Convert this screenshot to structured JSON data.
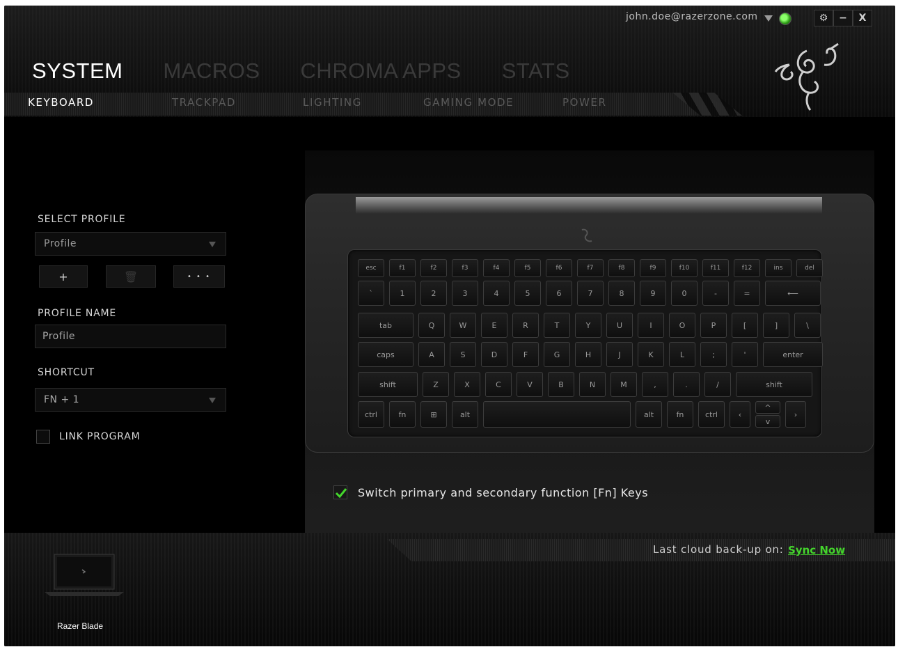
{
  "account": {
    "email": "john.doe@razerzone.com"
  },
  "window_controls": {
    "settings": "⚙",
    "minimize": "−",
    "close": "X"
  },
  "main_tabs": [
    {
      "label": "SYSTEM",
      "active": true
    },
    {
      "label": "MACROS",
      "active": false
    },
    {
      "label": "CHROMA APPS",
      "active": false
    },
    {
      "label": "STATS",
      "active": false
    }
  ],
  "sub_tabs": [
    {
      "label": "KEYBOARD",
      "active": true
    },
    {
      "label": "TRACKPAD",
      "active": false
    },
    {
      "label": "LIGHTING",
      "active": false
    },
    {
      "label": "GAMING MODE",
      "active": false
    },
    {
      "label": "POWER",
      "active": false
    }
  ],
  "profile": {
    "select_label": "SELECT PROFILE",
    "selected": "Profile",
    "add": "+",
    "delete": "🗑",
    "more": "• • •",
    "name_label": "PROFILE NAME",
    "name_value": "Profile",
    "shortcut_label": "SHORTCUT",
    "shortcut_value": "FN + 1",
    "link_program": "LINK PROGRAM"
  },
  "keyboard": {
    "rows": [
      [
        "esc",
        "f1",
        "f2",
        "f3",
        "f4",
        "f5",
        "f6",
        "f7",
        "f8",
        "f9",
        "f10",
        "f11",
        "f12",
        "ins",
        "del"
      ],
      [
        "`",
        "1",
        "2",
        "3",
        "4",
        "5",
        "6",
        "7",
        "8",
        "9",
        "0",
        "-",
        "=",
        "⟵"
      ],
      [
        "tab",
        "Q",
        "W",
        "E",
        "R",
        "T",
        "Y",
        "U",
        "I",
        "O",
        "P",
        "[",
        "]",
        "\\"
      ],
      [
        "caps",
        "A",
        "S",
        "D",
        "F",
        "G",
        "H",
        "J",
        "K",
        "L",
        ";",
        "'",
        "enter"
      ],
      [
        "shift",
        "Z",
        "X",
        "C",
        "V",
        "B",
        "N",
        "M",
        ",",
        ".",
        "/",
        "shift"
      ],
      [
        "ctrl",
        "fn",
        "⊞",
        "alt",
        "",
        "alt",
        "fn",
        "ctrl",
        "‹",
        "^",
        "v",
        "›"
      ]
    ]
  },
  "fn_switch": {
    "label": "Switch primary and secondary function [Fn] Keys",
    "checked": true
  },
  "sync": {
    "label": "Last cloud back-up on:",
    "link": "Sync Now"
  },
  "device": {
    "name": "Razer Blade"
  },
  "colors": {
    "accent": "#44d62c"
  }
}
